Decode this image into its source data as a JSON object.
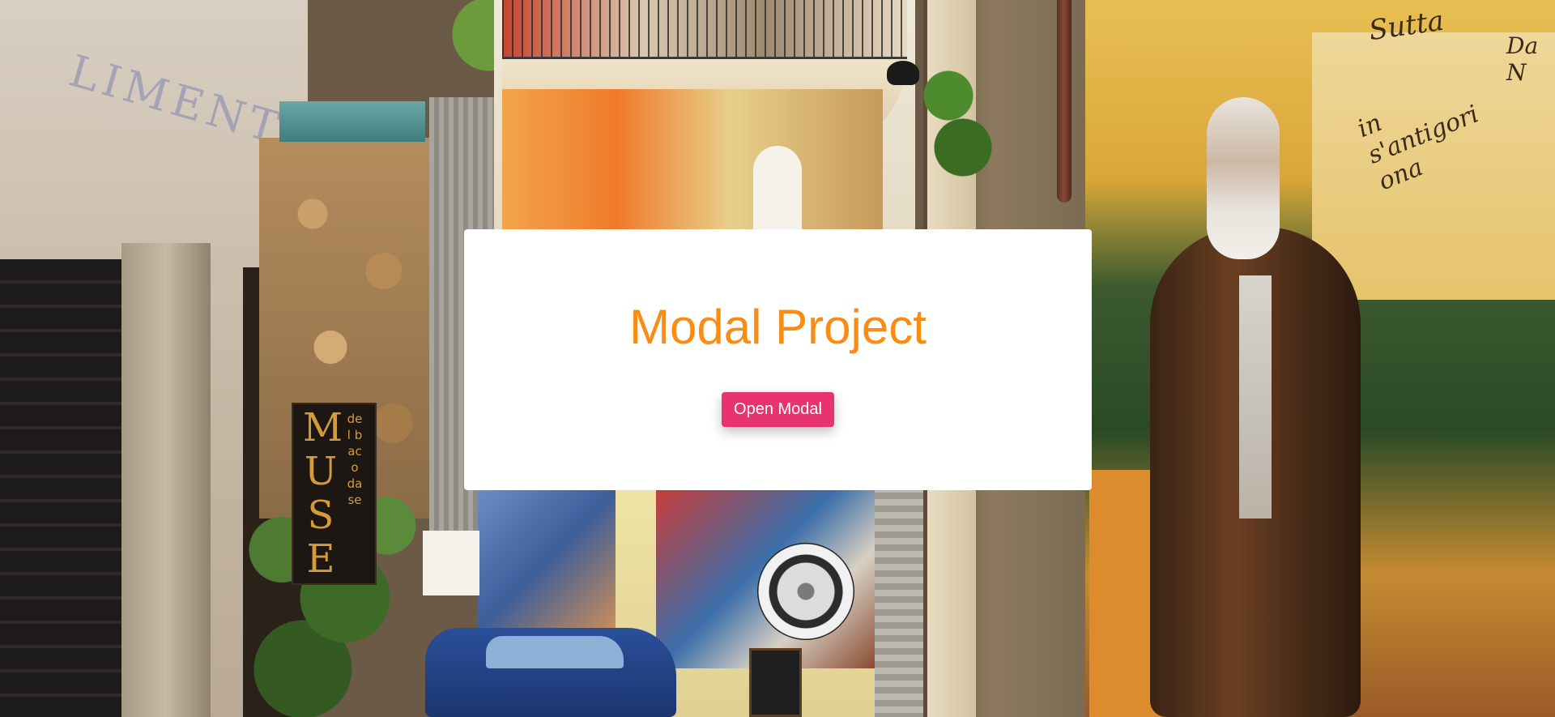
{
  "background": {
    "wall_lettering": "LIMENTARI",
    "museum_sign_large": "MUSE",
    "museum_sign_small": "del baco da se",
    "mural_writing_1": "Sutta",
    "mural_writing_2": "in s'antigori ona",
    "mural_writing_3": "Da N"
  },
  "modal": {
    "title": "Modal Project",
    "button_label": "Open Modal"
  },
  "colors": {
    "title": "#fa8c14",
    "button": "#e8336e",
    "card": "#ffffff"
  }
}
